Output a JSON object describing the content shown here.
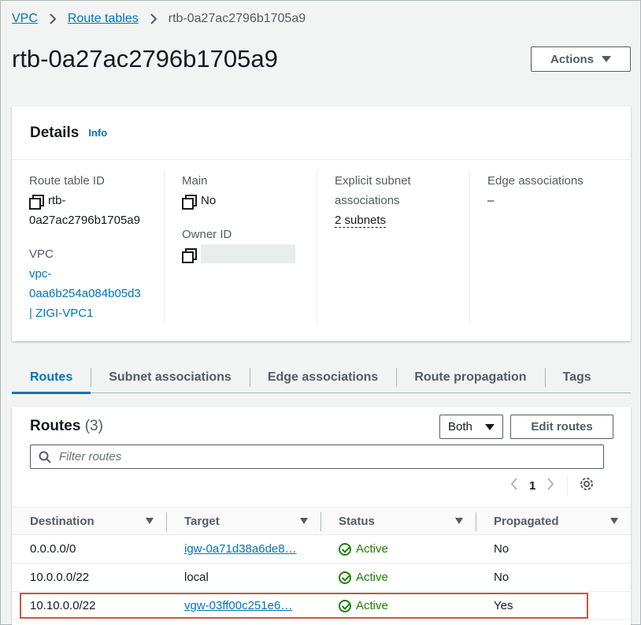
{
  "breadcrumb": {
    "items": [
      "VPC",
      "Route tables"
    ],
    "current": "rtb-0a27ac2796b1705a9"
  },
  "page": {
    "title": "rtb-0a27ac2796b1705a9",
    "actions_label": "Actions"
  },
  "details": {
    "title": "Details",
    "info": "Info",
    "route_table_id_label": "Route table ID",
    "route_table_id_line1": "rtb-",
    "route_table_id_line2": "0a27ac2796b1705a9",
    "vpc_label": "VPC",
    "vpc_line1": "vpc-",
    "vpc_line2": "0aa6b254a084b05d3",
    "vpc_line3": "| ZIGI-VPC1",
    "main_label": "Main",
    "main_value": "No",
    "owner_label": "Owner ID",
    "subnet_label_line1": "Explicit subnet",
    "subnet_label_line2": "associations",
    "subnet_value": "2 subnets",
    "edge_label": "Edge associations",
    "edge_value": "–"
  },
  "tabs": [
    "Routes",
    "Subnet associations",
    "Edge associations",
    "Route propagation",
    "Tags"
  ],
  "routes": {
    "title": "Routes",
    "count": "(3)",
    "filter_select": "Both",
    "edit_label": "Edit routes",
    "filter_placeholder": "Filter routes",
    "page": "1",
    "columns": [
      "Destination",
      "Target",
      "Status",
      "Propagated"
    ],
    "rows": [
      {
        "destination": "0.0.0.0/0",
        "target": "igw-0a71d38a6de8…",
        "status": "Active",
        "propagated": "No"
      },
      {
        "destination": "10.0.0.0/22",
        "target": "local",
        "status": "Active",
        "propagated": "No"
      },
      {
        "destination": "10.10.0.0/22",
        "target": "vgw-03ff00c251e6…",
        "status": "Active",
        "propagated": "Yes"
      }
    ]
  },
  "colors": {
    "link": "#0073bb",
    "active": "#1d8102",
    "highlight": "#c7553f"
  }
}
